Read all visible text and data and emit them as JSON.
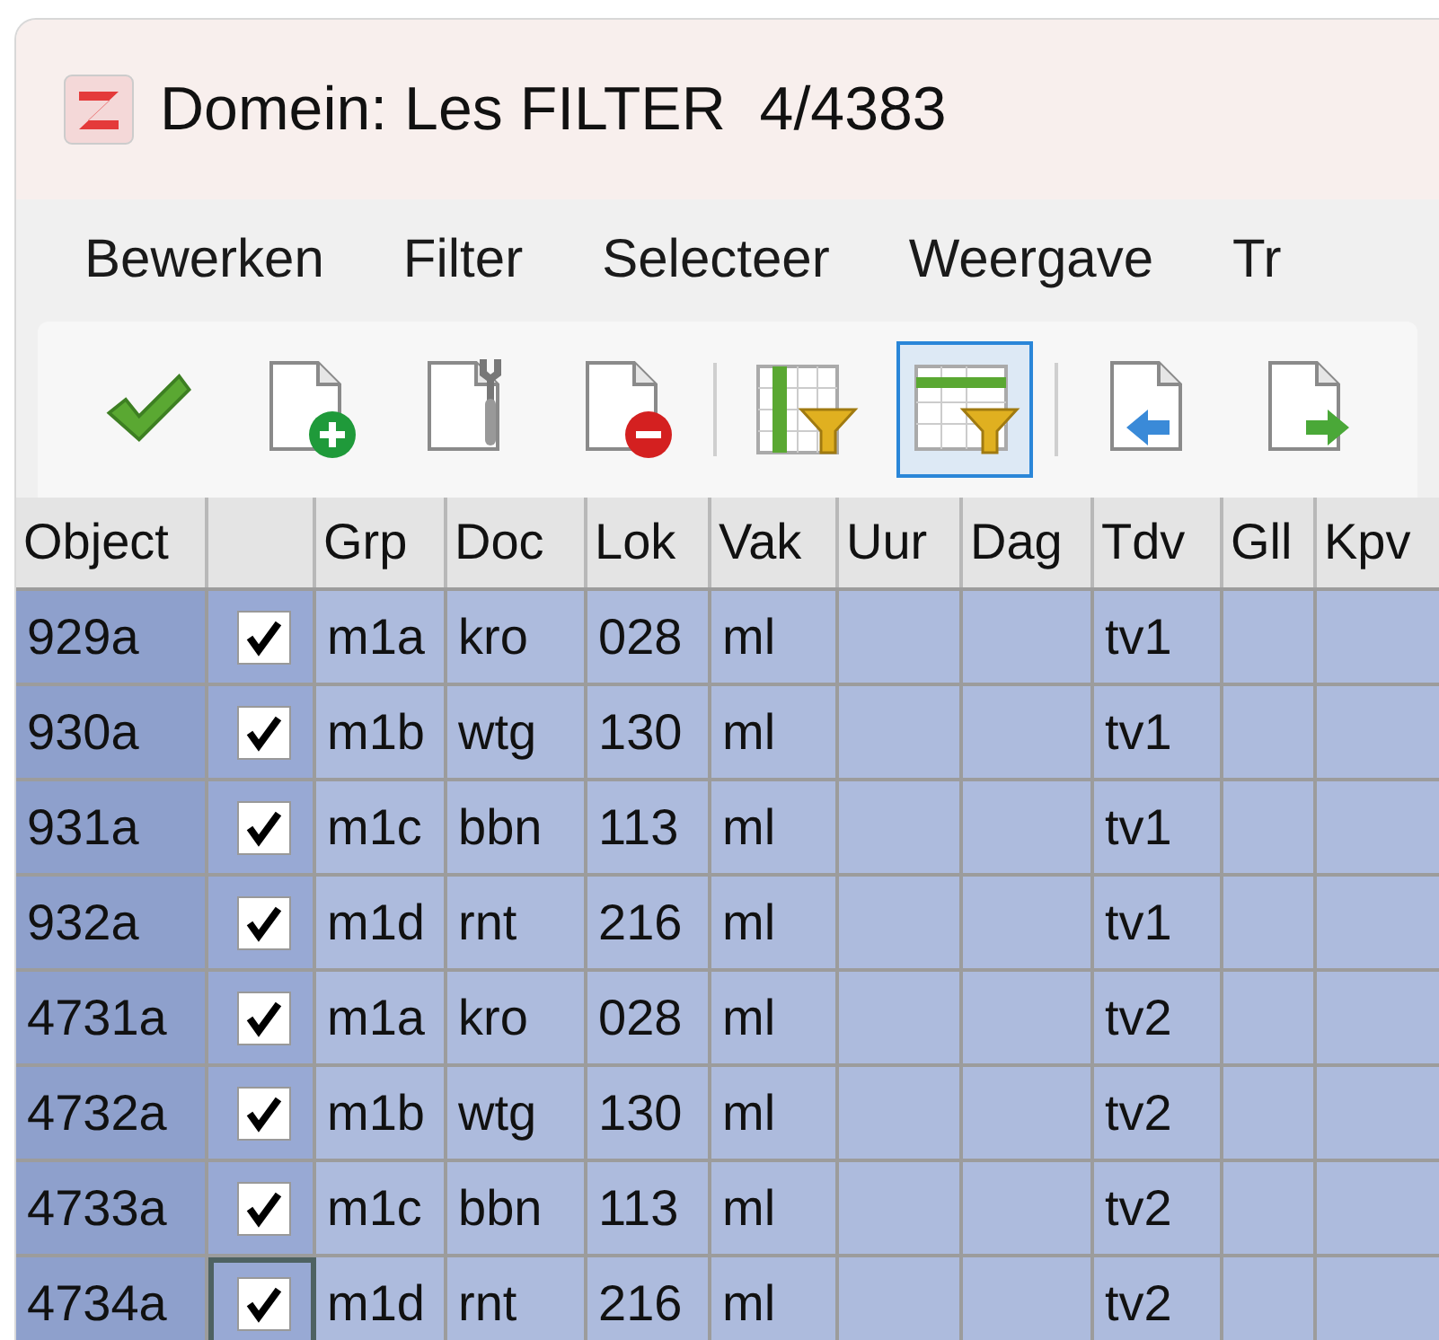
{
  "window": {
    "title": "Domein: Les FILTER  4/4383"
  },
  "menu": [
    "Bewerken",
    "Filter",
    "Selecteer",
    "Weergave",
    "Tr"
  ],
  "toolbar": [
    {
      "kind": "check",
      "selected": false
    },
    {
      "kind": "doc-add",
      "selected": false
    },
    {
      "kind": "doc-wrench",
      "selected": false
    },
    {
      "kind": "doc-remove",
      "selected": false
    },
    {
      "kind": "separator"
    },
    {
      "kind": "col-filter",
      "selected": false
    },
    {
      "kind": "row-filter",
      "selected": true
    },
    {
      "kind": "separator"
    },
    {
      "kind": "doc-left",
      "selected": false
    },
    {
      "kind": "doc-right",
      "selected": false
    }
  ],
  "table": {
    "columns": [
      "Object",
      "",
      "Grp",
      "Doc",
      "Lok",
      "Vak",
      "Uur",
      "Dag",
      "Tdv",
      "Gll",
      "Kpv"
    ],
    "rows": [
      {
        "checked": true,
        "focused": false,
        "cells": [
          "929a",
          "",
          "m1a",
          "kro",
          "028",
          "ml",
          "",
          "",
          "tv1",
          "",
          ""
        ]
      },
      {
        "checked": true,
        "focused": false,
        "cells": [
          "930a",
          "",
          "m1b",
          "wtg",
          "130",
          "ml",
          "",
          "",
          "tv1",
          "",
          ""
        ]
      },
      {
        "checked": true,
        "focused": false,
        "cells": [
          "931a",
          "",
          "m1c",
          "bbn",
          "113",
          "ml",
          "",
          "",
          "tv1",
          "",
          ""
        ]
      },
      {
        "checked": true,
        "focused": false,
        "cells": [
          "932a",
          "",
          "m1d",
          "rnt",
          "216",
          "ml",
          "",
          "",
          "tv1",
          "",
          ""
        ]
      },
      {
        "checked": true,
        "focused": false,
        "cells": [
          "4731a",
          "",
          "m1a",
          "kro",
          "028",
          "ml",
          "",
          "",
          "tv2",
          "",
          ""
        ]
      },
      {
        "checked": true,
        "focused": false,
        "cells": [
          "4732a",
          "",
          "m1b",
          "wtg",
          "130",
          "ml",
          "",
          "",
          "tv2",
          "",
          ""
        ]
      },
      {
        "checked": true,
        "focused": false,
        "cells": [
          "4733a",
          "",
          "m1c",
          "bbn",
          "113",
          "ml",
          "",
          "",
          "tv2",
          "",
          ""
        ]
      },
      {
        "checked": true,
        "focused": true,
        "cells": [
          "4734a",
          "",
          "m1d",
          "rnt",
          "216",
          "ml",
          "",
          "",
          "tv2",
          "",
          ""
        ]
      }
    ]
  }
}
